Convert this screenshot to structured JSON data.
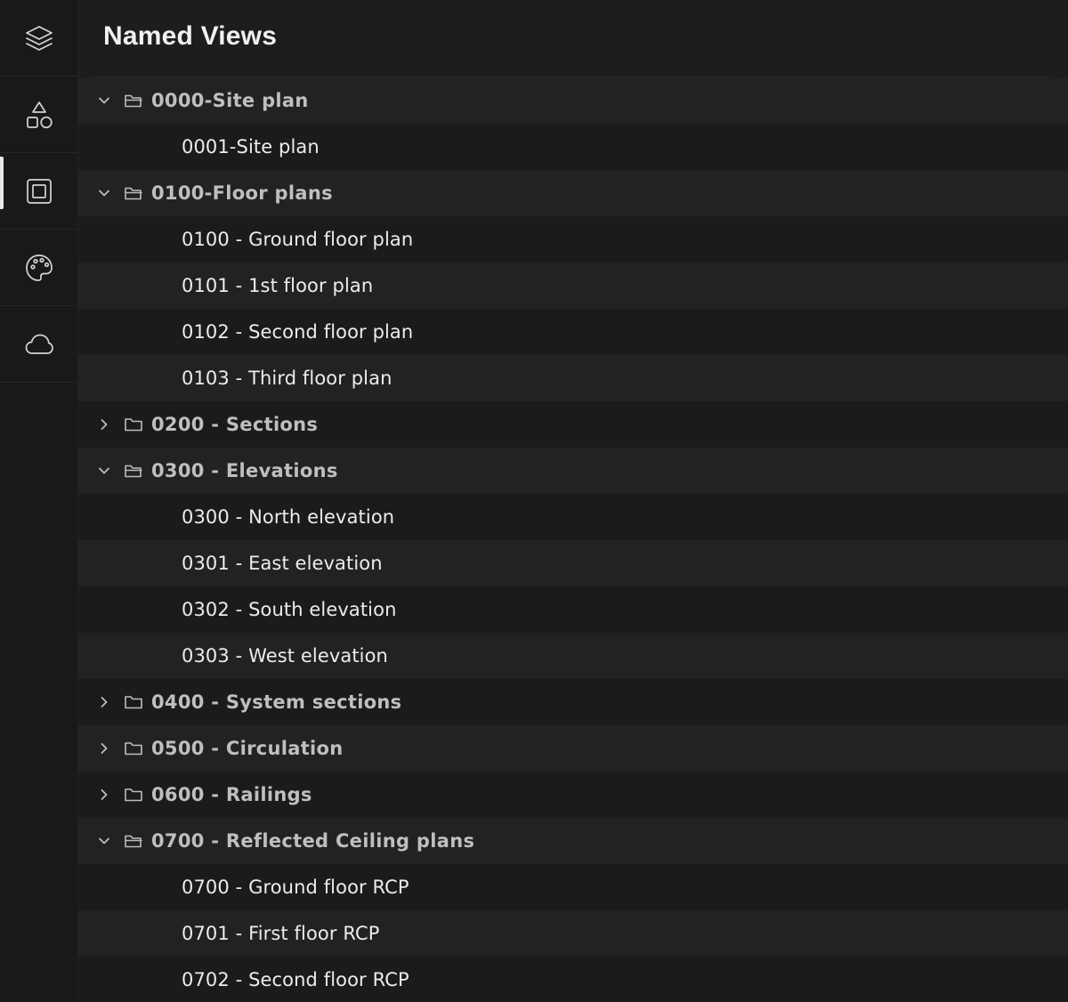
{
  "panel": {
    "title": "Named Views"
  },
  "rail": {
    "items": [
      {
        "name": "layers",
        "icon": "layers-icon"
      },
      {
        "name": "shapes",
        "icon": "shapes-icon"
      },
      {
        "name": "named-views",
        "icon": "square-frame-icon",
        "active": true
      },
      {
        "name": "palette",
        "icon": "palette-icon"
      },
      {
        "name": "cloud",
        "icon": "cloud-icon"
      }
    ]
  },
  "tree": [
    {
      "type": "group",
      "label": "0000-Site plan",
      "expanded": true
    },
    {
      "type": "item",
      "label": "0001-Site plan"
    },
    {
      "type": "group",
      "label": "0100-Floor plans",
      "expanded": true
    },
    {
      "type": "item",
      "label": "0100 - Ground floor plan"
    },
    {
      "type": "item",
      "label": "0101 - 1st floor plan"
    },
    {
      "type": "item",
      "label": "0102 - Second floor plan"
    },
    {
      "type": "item",
      "label": "0103 - Third floor plan"
    },
    {
      "type": "group",
      "label": "0200 - Sections",
      "expanded": false
    },
    {
      "type": "group",
      "label": "0300 - Elevations",
      "expanded": true
    },
    {
      "type": "item",
      "label": "0300 - North elevation"
    },
    {
      "type": "item",
      "label": "0301 - East elevation"
    },
    {
      "type": "item",
      "label": "0302 - South elevation"
    },
    {
      "type": "item",
      "label": "0303 - West elevation"
    },
    {
      "type": "group",
      "label": "0400 - System sections",
      "expanded": false
    },
    {
      "type": "group",
      "label": "0500 - Circulation",
      "expanded": false
    },
    {
      "type": "group",
      "label": "0600 - Railings",
      "expanded": false
    },
    {
      "type": "group",
      "label": "0700 - Reflected Ceiling plans",
      "expanded": true
    },
    {
      "type": "item",
      "label": "0700 - Ground floor RCP"
    },
    {
      "type": "item",
      "label": "0701 - First floor RCP"
    },
    {
      "type": "item",
      "label": "0702 - Second floor RCP"
    }
  ]
}
